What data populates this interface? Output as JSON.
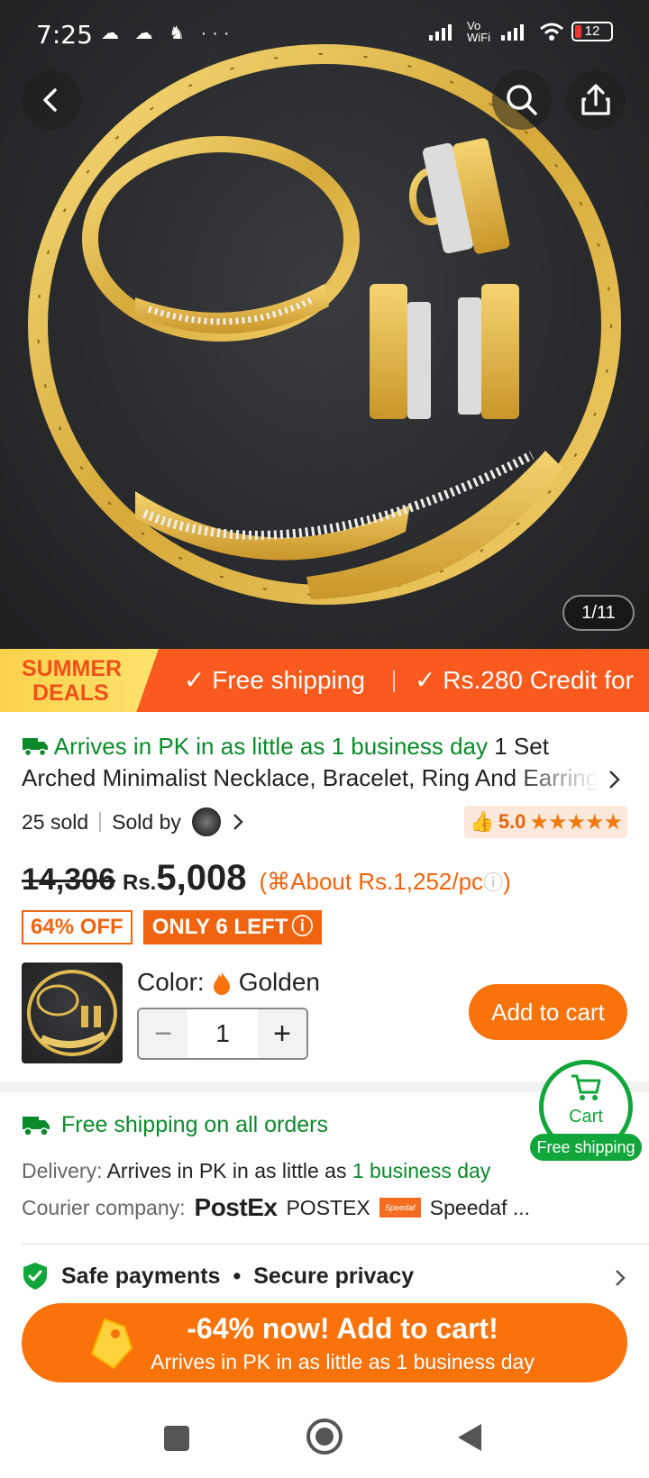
{
  "status_bar": {
    "time": "7:25",
    "left_icons": "☁ ☁ ♞ ···",
    "net_label": "Vo WiFi",
    "battery": "12"
  },
  "gallery": {
    "counter": "1/11"
  },
  "promo": {
    "deals_line1": "SUMMER",
    "deals_line2": "DEALS",
    "item1": "Free shipping",
    "item2": "Rs.280 Credit for"
  },
  "product": {
    "arrival_green": "Arrives in PK in as little as 1 business day",
    "title_part1": "1 Set",
    "title_part2": "Arched Minimalist Necklace, Bracelet, Ring And Earrings Set",
    "sold": "25 sold",
    "sold_by": "Sold by",
    "rating": "5.0",
    "stars": "★★★★★",
    "old_price": "14,306",
    "currency": "Rs.",
    "price": "5,008",
    "per_pc": "About Rs.1,252/pc",
    "discount_badge": "64% OFF",
    "stock_badge": "ONLY 6 LEFT",
    "color_label": "Color:",
    "color_value": "Golden",
    "qty": "1",
    "add_to_cart": "Add to cart"
  },
  "cart_float": {
    "label": "Cart",
    "tag": "Free shipping"
  },
  "shipping": {
    "headline": "Free shipping on all orders",
    "delivery_label": "Delivery:",
    "delivery_text": "Arrives in PK in as little as",
    "delivery_green": "1 business day",
    "courier_label": "Courier company:",
    "courier1_logo": "PostEx",
    "courier1": "POSTEX",
    "courier2_logo": "Speedaf",
    "courier2": "Speedaf ..."
  },
  "safe": {
    "text1": "Safe payments",
    "dot": "•",
    "text2": "Secure privacy"
  },
  "cta": {
    "main": "-64% now! Add to cart!",
    "sub": "Arrives in PK in as little as 1 business day"
  },
  "colors": {
    "accent": "#f9720a",
    "green": "#0a8a2a",
    "promo": "#fb5a1e"
  }
}
